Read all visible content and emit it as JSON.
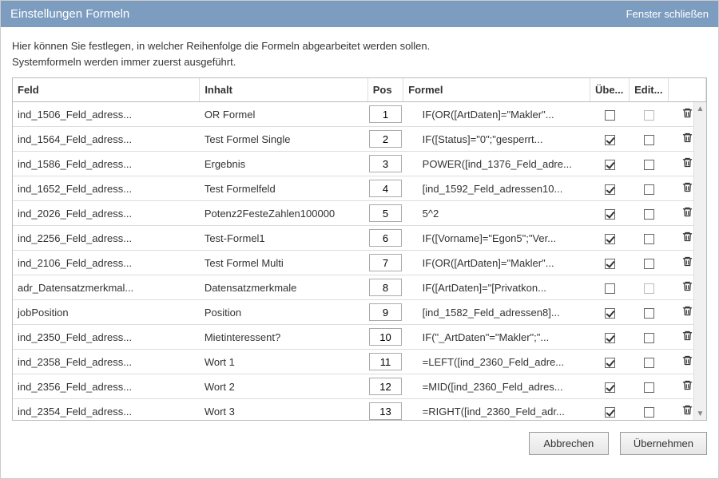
{
  "window": {
    "title": "Einstellungen Formeln",
    "close_label": "Fenster schließen"
  },
  "instructions": {
    "line1": "Hier können Sie festlegen, in welcher Reihenfolge die Formeln abgearbeitet werden sollen.",
    "line2": "Systemformeln werden immer zuerst ausgeführt."
  },
  "columns": {
    "feld": "Feld",
    "inhalt": "Inhalt",
    "pos": "Pos",
    "formel": "Formel",
    "uebe": "Übe...",
    "edit": "Edit..."
  },
  "rows": [
    {
      "feld": "ind_1506_Feld_adress...",
      "inhalt": "OR Formel",
      "pos": "1",
      "formel": "IF(OR([ArtDaten]=\"Makler\"...",
      "uebe": false,
      "edit_disabled": true
    },
    {
      "feld": "ind_1564_Feld_adress...",
      "inhalt": "Test Formel Single",
      "pos": "2",
      "formel": "IF([Status]=\"0\";\"gesperrt...",
      "uebe": true,
      "edit_disabled": false
    },
    {
      "feld": "ind_1586_Feld_adress...",
      "inhalt": "Ergebnis",
      "pos": "3",
      "formel": "POWER([ind_1376_Feld_adre...",
      "uebe": true,
      "edit_disabled": false
    },
    {
      "feld": "ind_1652_Feld_adress...",
      "inhalt": "Test Formelfeld",
      "pos": "4",
      "formel": "[ind_1592_Feld_adressen10...",
      "uebe": true,
      "edit_disabled": false
    },
    {
      "feld": "ind_2026_Feld_adress...",
      "inhalt": "Potenz2FesteZahlen100000",
      "pos": "5",
      "formel": "5^2",
      "uebe": true,
      "edit_disabled": false
    },
    {
      "feld": "ind_2256_Feld_adress...",
      "inhalt": "Test-Formel1",
      "pos": "6",
      "formel": "IF([Vorname]=\"Egon5\";\"Ver...",
      "uebe": true,
      "edit_disabled": false
    },
    {
      "feld": "ind_2106_Feld_adress...",
      "inhalt": "Test Formel Multi",
      "pos": "7",
      "formel": "IF(OR([ArtDaten]=\"Makler\"...",
      "uebe": true,
      "edit_disabled": false
    },
    {
      "feld": "adr_Datensatzmerkmal...",
      "inhalt": "Datensatzmerkmale",
      "pos": "8",
      "formel": "IF([ArtDaten]=\"[Privatkon...",
      "uebe": false,
      "edit_disabled": true
    },
    {
      "feld": "jobPosition",
      "inhalt": "Position",
      "pos": "9",
      "formel": "[ind_1582_Feld_adressen8]...",
      "uebe": true,
      "edit_disabled": false
    },
    {
      "feld": "ind_2350_Feld_adress...",
      "inhalt": "Mietinteressent?",
      "pos": "10",
      "formel": "IF(\"_ArtDaten\"=\"Makler\";\"...",
      "uebe": true,
      "edit_disabled": false
    },
    {
      "feld": "ind_2358_Feld_adress...",
      "inhalt": "Wort 1",
      "pos": "11",
      "formel": "=LEFT([ind_2360_Feld_adre...",
      "uebe": true,
      "edit_disabled": false
    },
    {
      "feld": "ind_2356_Feld_adress...",
      "inhalt": "Wort 2",
      "pos": "12",
      "formel": "=MID([ind_2360_Feld_adres...",
      "uebe": true,
      "edit_disabled": false
    },
    {
      "feld": "ind_2354_Feld_adress...",
      "inhalt": "Wort 3",
      "pos": "13",
      "formel": "=RIGHT([ind_2360_Feld_adr...",
      "uebe": true,
      "edit_disabled": false
    }
  ],
  "buttons": {
    "cancel": "Abbrechen",
    "apply": "Übernehmen"
  }
}
